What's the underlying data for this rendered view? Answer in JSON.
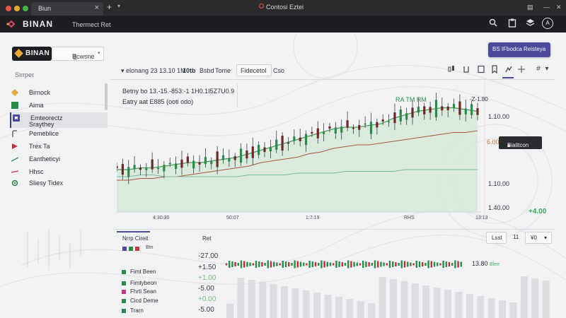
{
  "colors": {
    "accent": "#4d4a9e",
    "brand": "#e8a73a",
    "bull": "#2e8a4a",
    "bear": "#7a2a2a",
    "area": "#cfe6d2"
  },
  "browser": {
    "tab_title": "Biun",
    "tab_close": "×",
    "new_tab": "+",
    "url": "Contosi Eztei"
  },
  "header": {
    "brand": "BINAN",
    "subtitle": "Thermect Ret",
    "avatar_initial": "A",
    "icons": [
      "search-icon",
      "clipboard-icon",
      "layers-icon",
      "user-icon"
    ]
  },
  "sidebar": {
    "exchange": "BINAN",
    "pair": "Bcwsne",
    "pair_suffix": "'||",
    "section_title": "Sirrper",
    "items": [
      {
        "label": "Birnock",
        "icon": "diamond-icon"
      },
      {
        "label": "Aima",
        "icon": "square-icon"
      },
      {
        "label": "Emteorectz",
        "sub": "Sraythey",
        "icon": "bookmark-icon"
      },
      {
        "label": "Pemeblice",
        "icon": "path-icon"
      },
      {
        "label": "Trex Ta",
        "icon": "play-icon"
      },
      {
        "label": "Eantheticyi",
        "icon": "trend-line-icon"
      },
      {
        "label": "Hhsc",
        "icon": "red-line-icon"
      },
      {
        "label": "Sliesy Tidex",
        "icon": "gear-icon"
      }
    ]
  },
  "toolbar": {
    "cta": "BS IFbodca Reisteya",
    "symbol": "elonang 23 13.10 1M",
    "interval": "10tb",
    "mode": "Bsbd",
    "time": "Tome",
    "indicator": "Fidecetol",
    "compare": "Cso",
    "right_icons": [
      "candles-icon",
      "bracket-icon",
      "page-icon",
      "bookmark-icon",
      "magnet-icon",
      "crosshair-icon",
      "hash-icon",
      "chevron-down-icon"
    ]
  },
  "chart": {
    "ohlc_line1": "Betny bo 13.-15.-853:-1",
    "ohlc_line1_b": "1H0.1I5Z7U0.9",
    "ohlc_line2": "Eatry aat",
    "ohlc_line2_b": "E885 (ooti odo)",
    "top_marker": "RA  TM  RM",
    "top_right": "-Z-1.80",
    "price_badge": "Bialitcon",
    "price_badge_icon": "lock-icon",
    "price_marker": "6.00",
    "change": "+4.00"
  },
  "chart_data": {
    "type": "line",
    "title": "",
    "xlabel": "",
    "ylabel": "",
    "x_ticks": [
      "4:30:30",
      "50:07",
      "1:7:19",
      "RHS",
      "13:13"
    ],
    "y_ticks": [
      "1.10.00",
      "1.10.00",
      "1.40.00"
    ],
    "series": [
      {
        "values": [
          24,
          24,
          25,
          25,
          26,
          27,
          28,
          28,
          29,
          30,
          31,
          33,
          35,
          37,
          39,
          41,
          43,
          45,
          47,
          48,
          48,
          49,
          50,
          53,
          55,
          57,
          58,
          59,
          59,
          58,
          57
        ]
      },
      {
        "values": [
          18,
          18,
          19,
          19,
          20,
          20,
          21,
          22,
          23,
          24,
          25,
          26,
          28,
          29,
          30,
          31,
          33,
          34,
          36,
          37,
          38,
          38,
          39,
          40,
          41,
          42,
          43,
          44,
          45,
          45,
          46
        ]
      },
      {
        "values": [
          20,
          20,
          21,
          21,
          20,
          20,
          20,
          20,
          20,
          20,
          20,
          21,
          21,
          21,
          21,
          22,
          22,
          22,
          22,
          23,
          23,
          23,
          23,
          23,
          24,
          24,
          24,
          24,
          24,
          24,
          24
        ]
      }
    ],
    "grid": false
  },
  "bottom": {
    "tab": "Nrrp Cireit",
    "ret_label": "Ret",
    "buttons": [
      "Lsst",
      "11",
      "¥0"
    ],
    "legend": [
      "Btn"
    ],
    "rows": [
      {
        "name": "",
        "value": "-27.00",
        "sign": "neg"
      },
      {
        "name": "Fimt Been",
        "value": "+1.50",
        "sign": "pos"
      },
      {
        "name": "Fimtybeon",
        "value": "+1.00",
        "sign": "pos"
      },
      {
        "name": "Fhrti Sean",
        "value": "-5.00",
        "sign": "neg"
      },
      {
        "name": "Cicd Deme",
        "value": "+0.00",
        "sign": "pos"
      },
      {
        "name": "Trarn",
        "value": "-5.00",
        "sign": "neg"
      }
    ],
    "strip_price": "13.80",
    "strip_tag": "Blee"
  }
}
